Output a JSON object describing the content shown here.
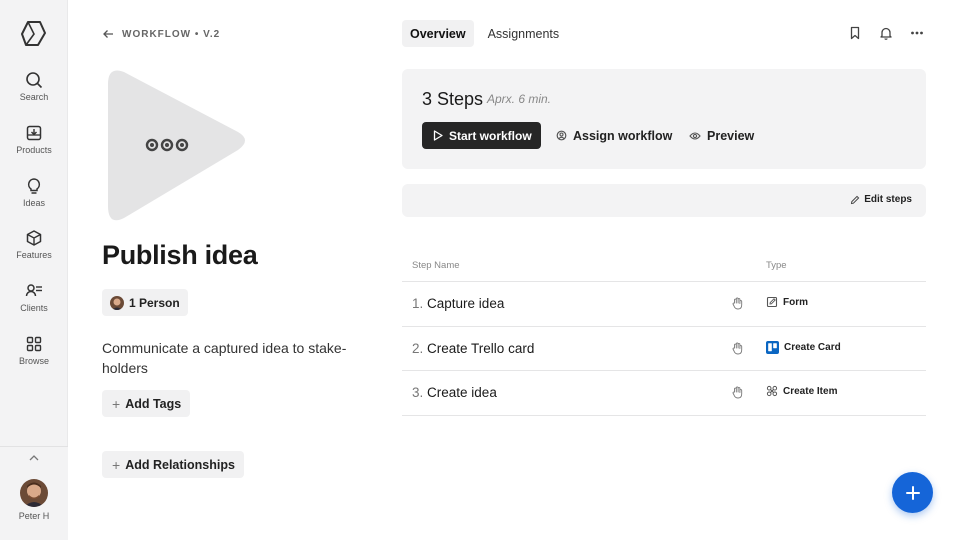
{
  "sidebar": {
    "items": [
      {
        "label": "Search",
        "icon": "search-icon"
      },
      {
        "label": "Products",
        "icon": "inbox-download-icon"
      },
      {
        "label": "Ideas",
        "icon": "lightbulb-icon"
      },
      {
        "label": "Features",
        "icon": "cube-icon"
      },
      {
        "label": "Clients",
        "icon": "people-list-icon"
      },
      {
        "label": "Browse",
        "icon": "grid-icon"
      }
    ],
    "user": {
      "name": "Peter H"
    }
  },
  "header": {
    "breadcrumb": "WORKFLOW • V.2",
    "tabs": [
      {
        "label": "Overview"
      },
      {
        "label": "Assignments"
      }
    ]
  },
  "workflow": {
    "title": "Publish idea",
    "people_chip": "1 Person",
    "description": "Communicate a captured idea to stake-holders",
    "add_tags": "Add Tags",
    "add_relationships": "Add Relationships"
  },
  "steps_card": {
    "count": "3 Steps",
    "duration": "Aprx. 6 min.",
    "start_button": "Start workflow",
    "assign_button": "Assign workflow",
    "preview_button": "Preview"
  },
  "edit_steps": "Edit steps",
  "table": {
    "headers": [
      "Step Name",
      "Type"
    ],
    "rows": [
      {
        "num": "1.",
        "name": "Capture idea",
        "type": "Form",
        "type_icon": "form-edit-icon"
      },
      {
        "num": "2.",
        "name": "Create Trello card",
        "type": "Create Card",
        "type_icon": "trello-icon"
      },
      {
        "num": "3.",
        "name": "Create idea",
        "type": "Create Item",
        "type_icon": "item-icon"
      }
    ]
  },
  "colors": {
    "accent": "#1565d8",
    "dark_button": "#262626",
    "sidebar_bg": "#f3f3f4",
    "trello": "#0a66c2"
  }
}
